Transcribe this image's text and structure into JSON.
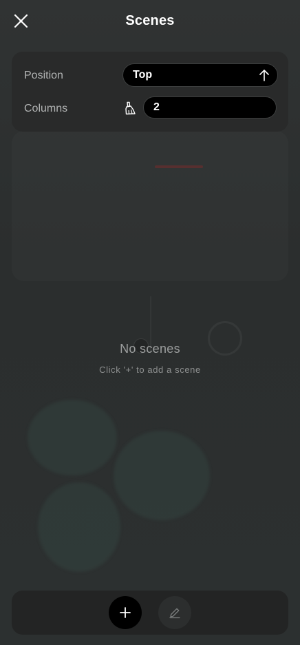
{
  "header": {
    "title": "Scenes",
    "close_icon": "close-icon"
  },
  "settings": {
    "position": {
      "label": "Position",
      "value": "Top",
      "icon": "arrow-up-icon"
    },
    "columns": {
      "label": "Columns",
      "value": "2",
      "reset_icon": "brush-icon"
    }
  },
  "empty_state": {
    "title": "No scenes",
    "subtitle": "Click '+' to add a scene"
  },
  "toolbar": {
    "add_icon": "plus-icon",
    "edit_icon": "pencil-icon"
  },
  "colors": {
    "panel": "#292a2a",
    "toolbar": "#232424",
    "field": "#000000",
    "label": "#b2b4b4",
    "muted": "#9c9e9e"
  }
}
